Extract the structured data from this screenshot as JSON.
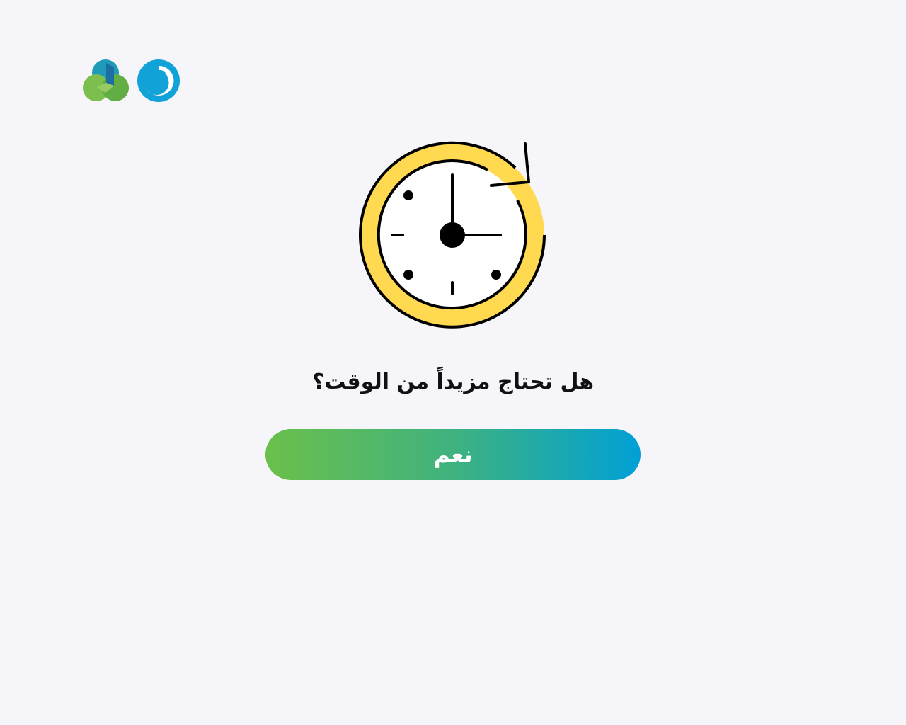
{
  "header": {
    "logos": [
      {
        "icon": "three-leaf-logo-icon"
      },
      {
        "icon": "blue-swirl-logo-icon"
      }
    ]
  },
  "illustration": {
    "icon": "clock-refresh-icon",
    "colors": {
      "ring": "#ffd94f",
      "face": "#ffffff",
      "stroke": "#000000"
    }
  },
  "prompt": {
    "question": "هل تحتاج مزيداً من الوقت؟"
  },
  "actions": {
    "yes_label": "نعم",
    "gradient": [
      "#6bc04b",
      "#00a0d6"
    ]
  },
  "theme": {
    "background": "#f6f6fa",
    "text": "#111111"
  }
}
